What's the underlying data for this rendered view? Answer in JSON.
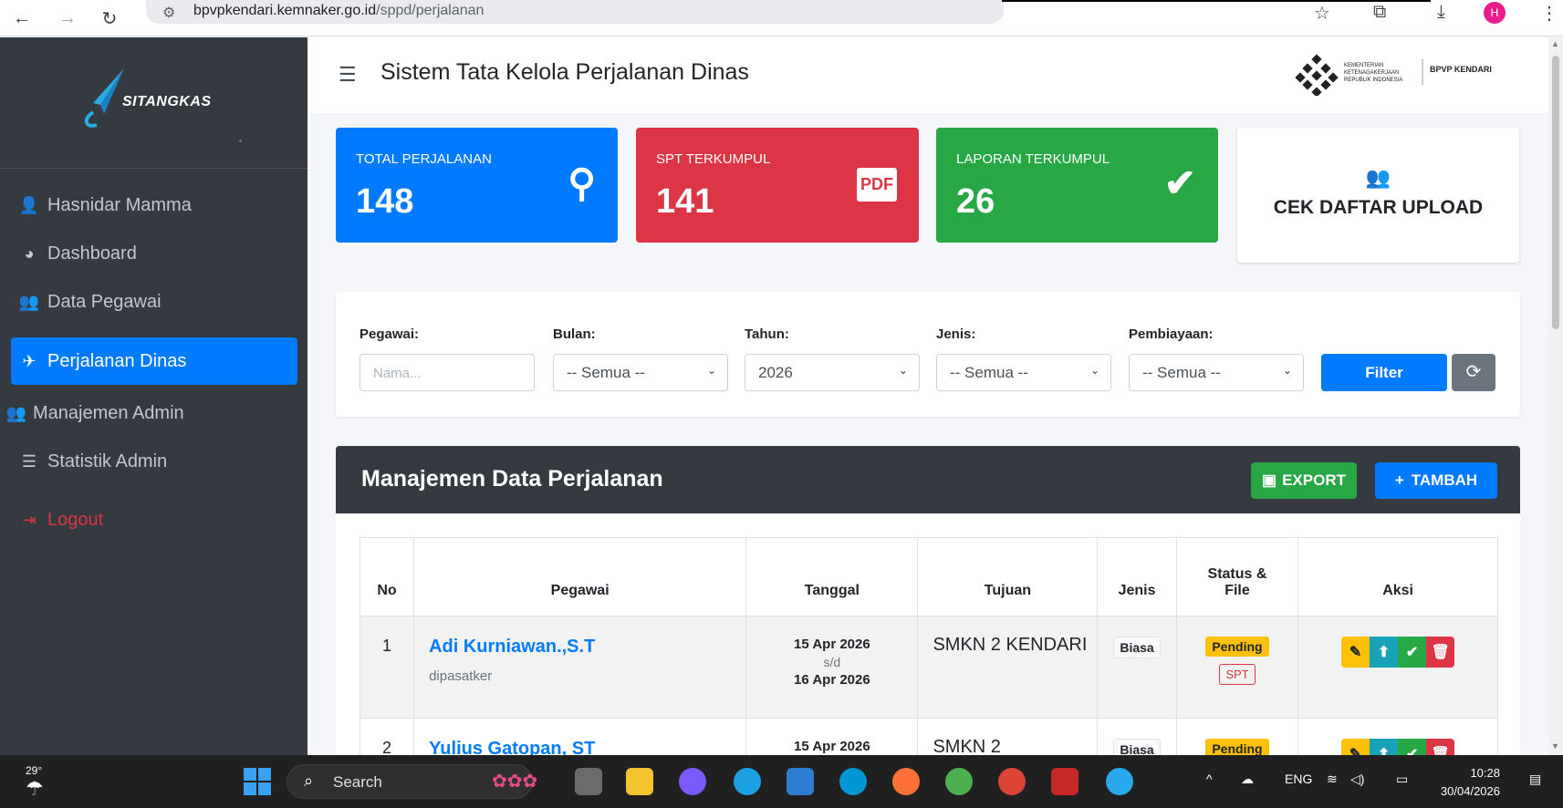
{
  "browser": {
    "url_host": "bpvpkendari.kemnaker.go.id",
    "url_path": "/sppd/perjalanan",
    "profile_initial": "H"
  },
  "sidebar": {
    "brand": "SITANGKAS",
    "items": [
      {
        "label": "Hasnidar Mamma",
        "icon": "user-icon",
        "glyph": "👤"
      },
      {
        "label": "Dashboard",
        "icon": "dashboard-icon",
        "glyph": "◕"
      },
      {
        "label": "Data Pegawai",
        "icon": "users-icon",
        "glyph": "👥"
      },
      {
        "label": "Perjalanan Dinas",
        "icon": "plane-icon",
        "glyph": "✈"
      },
      {
        "label": "Manajemen Admin",
        "icon": "users-gear-icon",
        "glyph": "👥"
      },
      {
        "label": "Statistik Admin",
        "icon": "chart-icon",
        "glyph": "☰"
      },
      {
        "label": "Logout",
        "icon": "logout-icon",
        "glyph": "⇥"
      }
    ]
  },
  "header": {
    "title": "Sistem Tata Kelola Perjalanan Dinas",
    "logo_lines": [
      "KEMENTERIAN",
      "KETENAGAKERJAAN",
      "REPUBLIK INDONESIA"
    ],
    "logo_right": "BPVP KENDARI"
  },
  "stats": [
    {
      "label": "TOTAL PERJALANAN",
      "value": "148",
      "color": "#007bff",
      "icon": "route-icon",
      "glyph": "⚲"
    },
    {
      "label": "SPT TERKUMPUL",
      "value": "141",
      "color": "#dc3545",
      "icon": "pdf-icon",
      "glyph": "PDF"
    },
    {
      "label": "LAPORAN TERKUMPUL",
      "value": "26",
      "color": "#28a745",
      "icon": "double-check-icon",
      "glyph": "✔"
    }
  ],
  "cek_upload": {
    "label": "CEK DAFTAR UPLOAD"
  },
  "filter": {
    "pegawai_label": "Pegawai:",
    "pegawai_placeholder": "Nama...",
    "bulan_label": "Bulan:",
    "bulan_value": "-- Semua --",
    "tahun_label": "Tahun:",
    "tahun_value": "2026",
    "jenis_label": "Jenis:",
    "jenis_value": "-- Semua --",
    "pembiayaan_label": "Pembiayaan:",
    "pembiayaan_value": "-- Semua --",
    "filter_button": "Filter"
  },
  "data": {
    "title": "Manajemen Data Perjalanan",
    "export_label": "EXPORT",
    "tambah_label": "TAMBAH",
    "columns": [
      "No",
      "Pegawai",
      "Tanggal",
      "Tujuan",
      "Jenis",
      "Status &",
      "File",
      "Aksi"
    ],
    "rows": [
      {
        "no": "1",
        "name": "Adi Kurniawan.,S.T",
        "sub": "dipasatker",
        "date_from": "15 Apr 2026",
        "sd": "s/d",
        "date_to": "16 Apr 2026",
        "tujuan": "SMKN 2 KENDARI",
        "jenis": "Biasa",
        "status": "Pending",
        "file": "SPT"
      },
      {
        "no": "2",
        "name": "Yulius Gatopan, ST",
        "sub": "",
        "date_from": "15 Apr 2026",
        "sd": "",
        "date_to": "",
        "tujuan": "SMKN 2",
        "jenis": "Biasa",
        "status": "Pending",
        "file": ""
      }
    ]
  },
  "taskbar": {
    "temp": "29°",
    "search": "Search",
    "lang": "ENG",
    "time": "10:28",
    "date": "30/04/2026"
  }
}
